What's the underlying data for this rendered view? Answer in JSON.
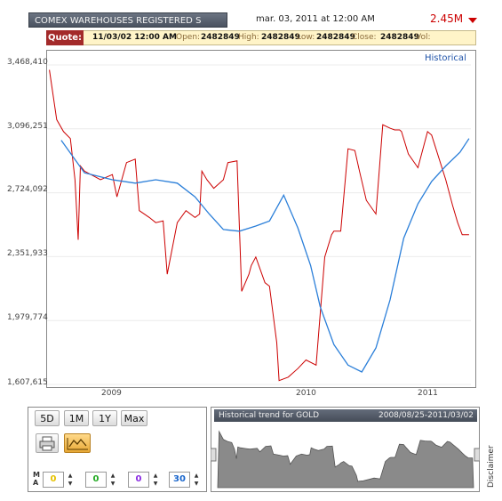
{
  "header": {
    "title": "COMEX WAREHOUSES REGISTERED S",
    "date": "mar. 03, 2011 at 12:00 AM",
    "value": "2.45M",
    "value_color": "#cc0000"
  },
  "quote": {
    "label": "Quote:",
    "datetime": "11/03/02 12:00 AM",
    "open_label": "Open:",
    "open": "2482849",
    "high_label": "High:",
    "high": "2482849",
    "low_label": "Low:",
    "low": "2482849",
    "close_label": "Close:",
    "close": "2482849",
    "vol_label": "Vol:"
  },
  "chart": {
    "historical_label": "Historical",
    "y_labels": [
      "3,468,410",
      "3,096,251",
      "2,724,092",
      "2,351,933",
      "1,979,774",
      "1,607,615"
    ],
    "x_labels": [
      "2009",
      "2010",
      "2011"
    ]
  },
  "chart_data": {
    "type": "line",
    "ylim": [
      1607615,
      3468410
    ],
    "series": [
      {
        "color": "#cc0000",
        "x": [
          "2008-08-25",
          "2008-09-10",
          "2008-09-25",
          "2008-10-10",
          "2008-10-20",
          "2008-10-27",
          "2008-11-01",
          "2008-11-10",
          "2008-12-01",
          "2008-12-15",
          "2009-01-10",
          "2009-01-20",
          "2009-02-10",
          "2009-03-01",
          "2009-03-10",
          "2009-04-01",
          "2009-04-15",
          "2009-05-01",
          "2009-05-10",
          "2009-06-01",
          "2009-06-20",
          "2009-07-10",
          "2009-07-20",
          "2009-07-25",
          "2009-08-05",
          "2009-08-20",
          "2009-09-10",
          "2009-09-20",
          "2009-10-10",
          "2009-10-20",
          "2009-11-05",
          "2009-11-10",
          "2009-11-20",
          "2009-12-10",
          "2009-12-20",
          "2010-01-05",
          "2010-01-10",
          "2010-01-30",
          "2010-02-20",
          "2010-03-10",
          "2010-04-01",
          "2010-04-20",
          "2010-05-05",
          "2010-05-10",
          "2010-05-25",
          "2010-06-10",
          "2010-06-25",
          "2010-07-05",
          "2010-07-20",
          "2010-08-10",
          "2010-08-25",
          "2010-09-10",
          "2010-09-20",
          "2010-10-01",
          "2010-10-05",
          "2010-10-20",
          "2010-11-10",
          "2010-12-01",
          "2010-12-10",
          "2011-01-10",
          "2011-01-25",
          "2011-02-05",
          "2011-02-15",
          "2011-02-25",
          "2011-03-02"
        ],
        "values": [
          3440000,
          3150000,
          3080000,
          3040000,
          2800000,
          2450000,
          2880000,
          2850000,
          2820000,
          2800000,
          2830000,
          2700000,
          2900000,
          2920000,
          2620000,
          2580000,
          2550000,
          2560000,
          2250000,
          2550000,
          2620000,
          2580000,
          2600000,
          2850000,
          2800000,
          2750000,
          2800000,
          2900000,
          2910000,
          2150000,
          2250000,
          2300000,
          2350000,
          2200000,
          2180000,
          1850000,
          1630000,
          1650000,
          1700000,
          1750000,
          1720000,
          2350000,
          2480000,
          2500000,
          2500000,
          2980000,
          2970000,
          2850000,
          2680000,
          2600000,
          3120000,
          3100000,
          3090000,
          3090000,
          3080000,
          2950000,
          2870000,
          3080000,
          3060000,
          2800000,
          2650000,
          2550000,
          2480000,
          2480000,
          2480000
        ]
      },
      {
        "color": "#2b7fd9",
        "x": [
          "2008-09-20",
          "2008-11-10",
          "2009-01-10",
          "2009-03-01",
          "2009-04-15",
          "2009-06-01",
          "2009-07-10",
          "2009-08-10",
          "2009-09-10",
          "2009-10-15",
          "2009-11-20",
          "2009-12-20",
          "2010-01-20",
          "2010-02-20",
          "2010-03-20",
          "2010-04-10",
          "2010-05-10",
          "2010-06-10",
          "2010-07-10",
          "2010-08-10",
          "2010-09-10",
          "2010-10-10",
          "2010-11-10",
          "2010-12-10",
          "2011-01-10",
          "2011-02-10",
          "2011-03-02"
        ],
        "values": [
          3030000,
          2840000,
          2800000,
          2780000,
          2800000,
          2780000,
          2700000,
          2600000,
          2510000,
          2500000,
          2530000,
          2560000,
          2710000,
          2520000,
          2300000,
          2060000,
          1840000,
          1720000,
          1680000,
          1820000,
          2100000,
          2460000,
          2660000,
          2790000,
          2880000,
          2960000,
          3040000
        ]
      }
    ]
  },
  "controls": {
    "periods": [
      "5D",
      "1M",
      "1Y",
      "Max"
    ],
    "print_icon": "printer-icon",
    "chart_type_icon": "line-chart-icon",
    "ma_label": "MA",
    "ma_values": [
      "0",
      "0",
      "0",
      "30"
    ],
    "ma_colors": [
      "#e6c200",
      "#22aa22",
      "#8a2be2",
      "#1a66cc"
    ]
  },
  "navigator": {
    "title": "Historical trend for GOLD",
    "range": "2008/08/25-2011/03/02",
    "disclaimer": "Disclaimer"
  }
}
